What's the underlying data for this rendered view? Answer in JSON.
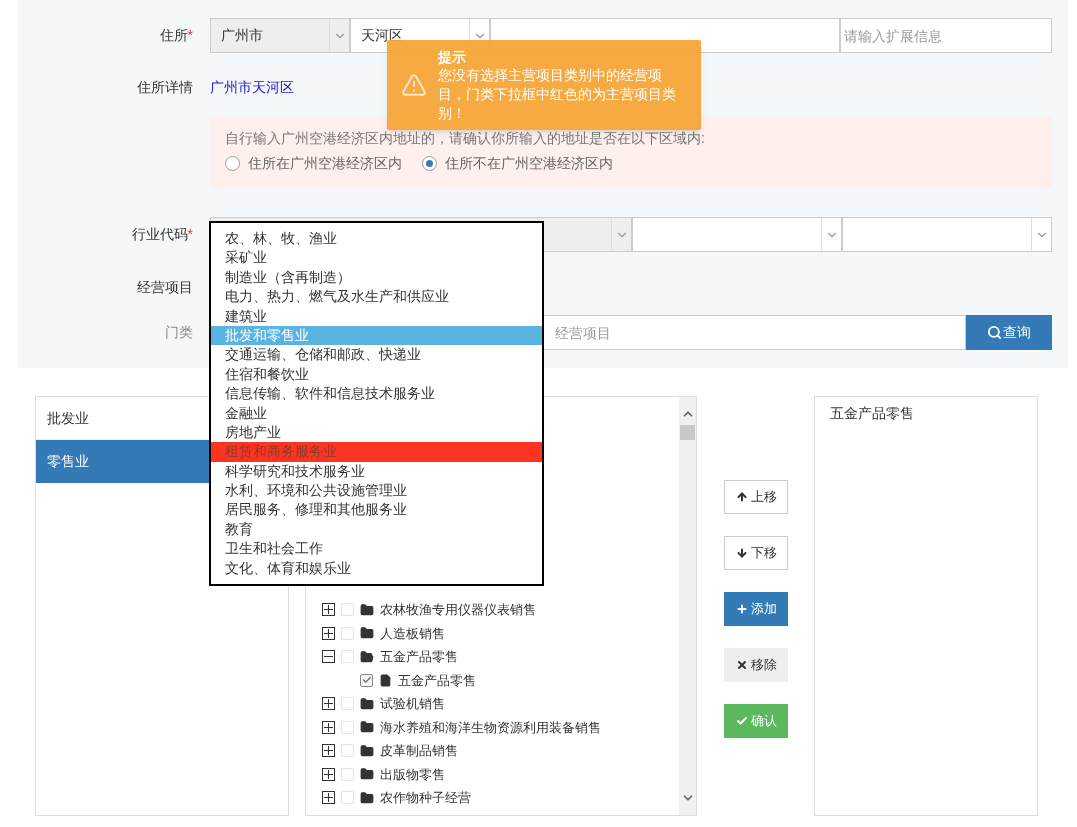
{
  "address": {
    "label": "住所",
    "required_mark": "*",
    "city": "广州市",
    "district": "天河区",
    "extra_placeholder": "请输入扩展信息"
  },
  "address_detail": {
    "label": "住所详情",
    "value": "广州市天河区"
  },
  "notice": {
    "text": "自行输入广州空港经济区内地址的，请确认你所输入的地址是否在以下区域内:",
    "options": [
      {
        "label": "住所在广州空港经济区内",
        "selected": false
      },
      {
        "label": "住所不在广州空港经济区内",
        "selected": true
      }
    ]
  },
  "industry": {
    "label": "行业代码",
    "required_mark": "*"
  },
  "business": {
    "label": "经营项目",
    "category_label": "门类",
    "search_placeholder": "经营项目",
    "search_button": "查询"
  },
  "category_dropdown": [
    {
      "label": "农、林、牧、渔业",
      "selected": false,
      "main": false
    },
    {
      "label": "采矿业",
      "selected": false,
      "main": false
    },
    {
      "label": "制造业（含再制造）",
      "selected": false,
      "main": false
    },
    {
      "label": "电力、热力、燃气及水生产和供应业",
      "selected": false,
      "main": false
    },
    {
      "label": "建筑业",
      "selected": false,
      "main": false
    },
    {
      "label": "批发和零售业",
      "selected": true,
      "main": false
    },
    {
      "label": "交通运输、仓储和邮政、快递业",
      "selected": false,
      "main": false
    },
    {
      "label": "住宿和餐饮业",
      "selected": false,
      "main": false
    },
    {
      "label": "信息传输、软件和信息技术服务业",
      "selected": false,
      "main": false
    },
    {
      "label": "金融业",
      "selected": false,
      "main": false
    },
    {
      "label": "房地产业",
      "selected": false,
      "main": false
    },
    {
      "label": "租赁和商务服务业",
      "selected": false,
      "main": true
    },
    {
      "label": "科学研究和技术服务业",
      "selected": false,
      "main": false
    },
    {
      "label": "水利、环境和公共设施管理业",
      "selected": false,
      "main": false
    },
    {
      "label": "居民服务、修理和其他服务业",
      "selected": false,
      "main": false
    },
    {
      "label": "教育",
      "selected": false,
      "main": false
    },
    {
      "label": "卫生和社会工作",
      "selected": false,
      "main": false
    },
    {
      "label": "文化、体育和娱乐业",
      "selected": false,
      "main": false
    }
  ],
  "toast": {
    "title": "提示",
    "message": "您没有选择主营项目类别中的经营项目，门类下拉框中红色的为主营项目类别！"
  },
  "subcategories": [
    {
      "label": "批发业",
      "selected": false
    },
    {
      "label": "零售业",
      "selected": true
    }
  ],
  "tree": [
    {
      "label": "农林牧渔专用仪器仪表销售",
      "expanded": false,
      "checked": false
    },
    {
      "label": "人造板销售",
      "expanded": false,
      "checked": false
    },
    {
      "label": "五金产品零售",
      "expanded": true,
      "checked": false,
      "children": [
        {
          "label": "五金产品零售",
          "checked": true
        }
      ]
    },
    {
      "label": "试验机销售",
      "expanded": false,
      "checked": false
    },
    {
      "label": "海水养殖和海洋生物资源利用装备销售",
      "expanded": false,
      "checked": false
    },
    {
      "label": "皮革制品销售",
      "expanded": false,
      "checked": false
    },
    {
      "label": "出版物零售",
      "expanded": false,
      "checked": false
    },
    {
      "label": "农作物种子经营",
      "expanded": false,
      "checked": false
    }
  ],
  "actions": [
    {
      "label": "上移",
      "kind": "up"
    },
    {
      "label": "下移",
      "kind": "down"
    },
    {
      "label": "添加",
      "kind": "add"
    },
    {
      "label": "移除",
      "kind": "remove"
    },
    {
      "label": "确认",
      "kind": "confirm"
    }
  ],
  "chosen": [
    {
      "label": "五金产品零售"
    }
  ]
}
